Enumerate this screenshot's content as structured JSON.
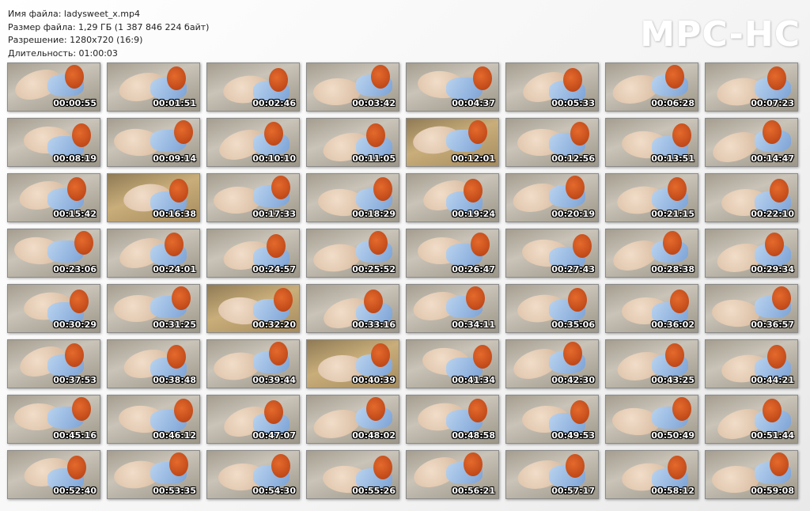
{
  "info": {
    "filename": "Имя файла: ladysweet_x.mp4",
    "filesize": "Размер файла: 1,29 ГБ (1 387 846 224 байт)",
    "resolution": "Разрешение: 1280x720 (16:9)",
    "duration": "Длительность: 01:00:03"
  },
  "logo": "MPC-HC",
  "thumbnails": [
    "00:00:55",
    "00:01:51",
    "00:02:46",
    "00:03:42",
    "00:04:37",
    "00:05:33",
    "00:06:28",
    "00:07:23",
    "00:08:19",
    "00:09:14",
    "00:10:10",
    "00:11:05",
    "00:12:01",
    "00:12:56",
    "00:13:51",
    "00:14:47",
    "00:15:42",
    "00:16:38",
    "00:17:33",
    "00:18:29",
    "00:19:24",
    "00:20:19",
    "00:21:15",
    "00:22:10",
    "00:23:06",
    "00:24:01",
    "00:24:57",
    "00:25:52",
    "00:26:47",
    "00:27:43",
    "00:28:38",
    "00:29:34",
    "00:30:29",
    "00:31:25",
    "00:32:20",
    "00:33:16",
    "00:34:11",
    "00:35:06",
    "00:36:02",
    "00:36:57",
    "00:37:53",
    "00:38:48",
    "00:39:44",
    "00:40:39",
    "00:41:34",
    "00:42:30",
    "00:43:25",
    "00:44:21",
    "00:45:16",
    "00:46:12",
    "00:47:07",
    "00:48:02",
    "00:48:58",
    "00:49:53",
    "00:50:49",
    "00:51:44",
    "00:52:40",
    "00:53:35",
    "00:54:30",
    "00:55:26",
    "00:56:21",
    "00:57:17",
    "00:58:12",
    "00:59:08"
  ]
}
